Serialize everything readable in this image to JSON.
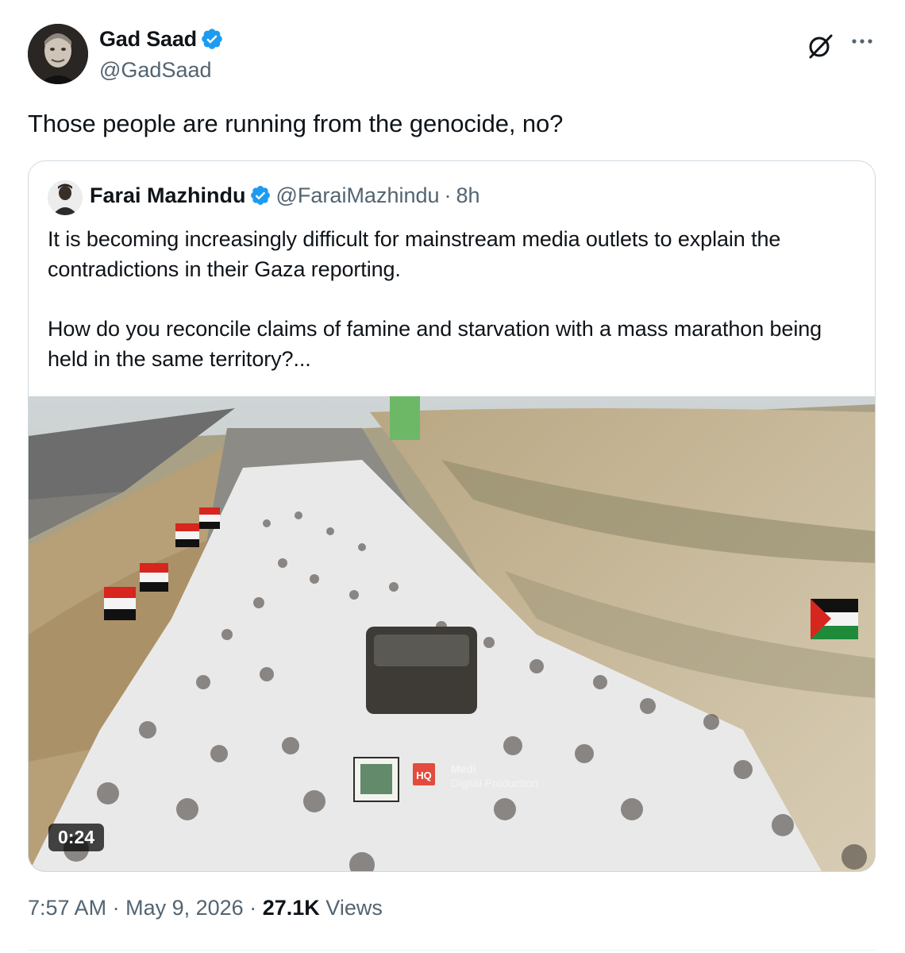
{
  "tweet": {
    "author_name": "Gad Saad",
    "author_handle": "@GadSaad",
    "text": "Those people are running from the genocide, no?",
    "icons": {
      "avatar": "profile-photo",
      "verified": "verified-badge-icon",
      "grok": "grok-icon",
      "more": "more-options-icon"
    },
    "posted_time": "7:57 AM",
    "separator": "·",
    "posted_date": "May 9, 2026",
    "views_count": "27.1K",
    "views_label": "Views"
  },
  "quote": {
    "author_name": "Farai Mazhindu",
    "author_handle": "@FaraiMazhindu",
    "separator": "·",
    "age": "8h",
    "paragraph1": "It is becoming increasingly difficult for mainstream media outlets to explain the contradictions in their Gaza reporting.",
    "paragraph2": "How do you reconcile claims of famine and starvation with a mass marathon being held in the same territory?...",
    "video": {
      "duration": "0:24",
      "watermark_badge": "HQ",
      "watermark_line1": "Medi",
      "watermark_line2": "Digital Production"
    }
  },
  "colors": {
    "text": "#0f1419",
    "secondary": "#536471",
    "verified_blue": "#1d9bf0",
    "border": "#cfd9de"
  }
}
